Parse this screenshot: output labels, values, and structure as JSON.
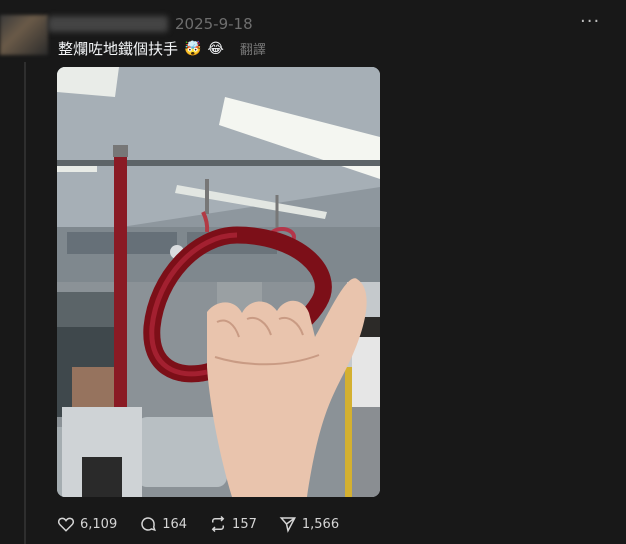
{
  "post": {
    "timestamp": "2025-9-18",
    "text": "整爛咗地鐵個扶手",
    "emojis": [
      "🤯",
      "😂"
    ],
    "translate_label": "翻譯",
    "more_icon": "more-horizontal-icon"
  },
  "actions": {
    "likes": "6,109",
    "replies": "164",
    "reposts": "157",
    "shares": "1,566"
  },
  "icons": {
    "like": "heart-icon",
    "reply": "comment-icon",
    "repost": "repost-icon",
    "share": "send-icon"
  }
}
